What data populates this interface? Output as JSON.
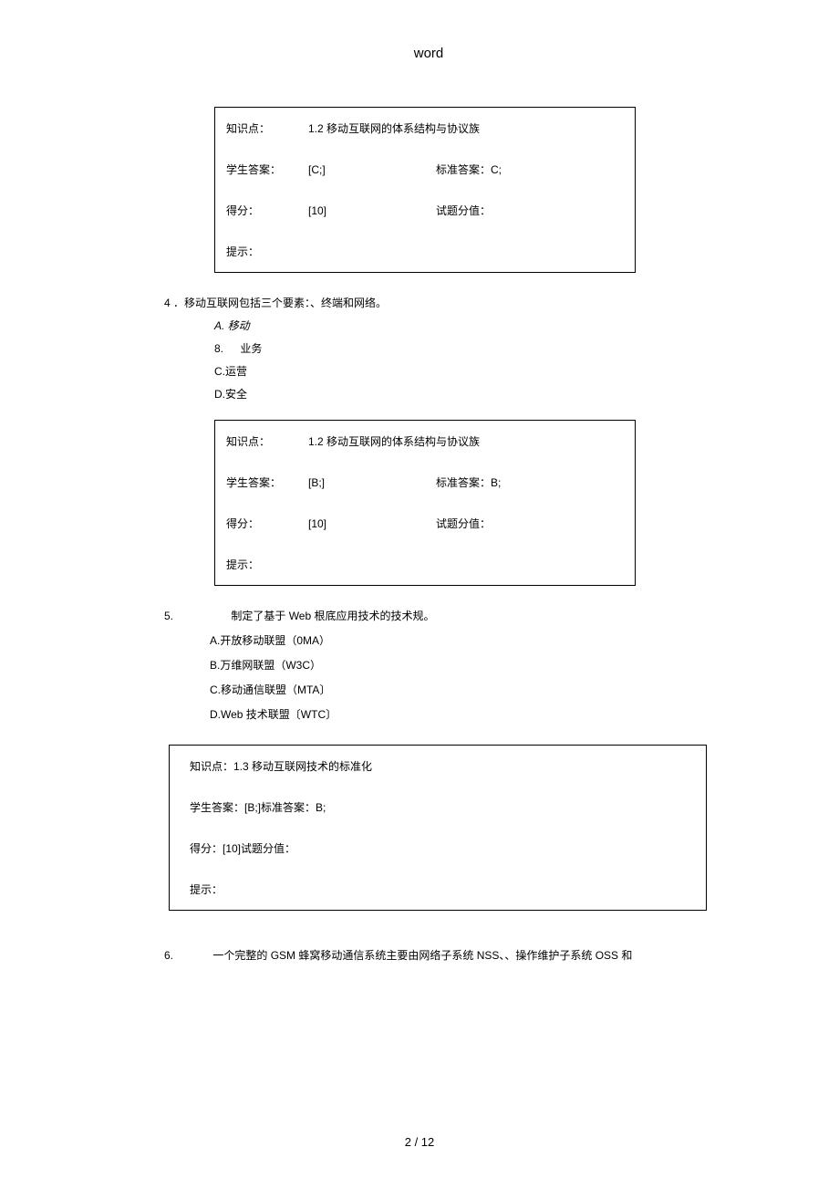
{
  "header": "word",
  "box1": {
    "knowledge_label": "知识点：",
    "knowledge_value": "1.2 移动互联网的体系结构与协议族",
    "student_label": "学生答案：",
    "student_value": "[C;]",
    "standard_label": "标准答案：",
    "standard_value": "C;",
    "score_label": "得分：",
    "score_value": "[10]",
    "qscore_label": "试题分值：",
    "hint_label": "提示："
  },
  "q4": {
    "num": "4",
    "text": "．移动互联网包括三个要素：、终端和网络。",
    "optA": "A. 移动",
    "optB_num": "8.",
    "optB_text": "业务",
    "optC": "C.运营",
    "optD": "D.安全"
  },
  "box2": {
    "knowledge_label": "知识点：",
    "knowledge_value": "1.2 移动互联网的体系结构与协议族",
    "student_label": "学生答案：",
    "student_value": "[B;]",
    "standard_label": "标准答案：",
    "standard_value": "B;",
    "score_label": "得分：",
    "score_value": "[10]",
    "qscore_label": "试题分值：",
    "hint_label": "提示："
  },
  "q5": {
    "num": "5.",
    "text": "制定了基于 Web 根底应用技术的技术规。",
    "optA": "A.开放移动联盟（0MA）",
    "optB": "B.万维网联盟（W3C）",
    "optC": "C.移动通信联盟（MTA〕",
    "optD": "D.Web 技术联盟〔WTC〕"
  },
  "box3": {
    "knowledge_line": "知识点：1.3 移动互联网技术的标准化",
    "student_line": "学生答案：[B;]标准答案：B;",
    "score_line": "得分：[10]试题分值：",
    "hint_line": "提示："
  },
  "q6": {
    "num": "6.",
    "text": "一个完整的 GSM 蜂窝移动通信系统主要由网络子系统 NSS、、操作维护子系统 OSS 和"
  },
  "footer": "2 / 12"
}
